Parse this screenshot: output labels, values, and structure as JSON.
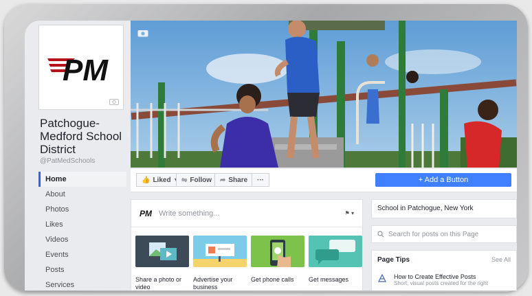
{
  "page": {
    "name": "Patchogue-Medford School District",
    "name_lines": [
      "Patchogue-",
      "Medford School",
      "District"
    ],
    "handle": "@PatMedSchools",
    "logo_text": "PM"
  },
  "nav": [
    {
      "label": "Home",
      "active": true
    },
    {
      "label": "About"
    },
    {
      "label": "Photos"
    },
    {
      "label": "Likes"
    },
    {
      "label": "Videos"
    },
    {
      "label": "Events"
    },
    {
      "label": "Posts"
    },
    {
      "label": "Services"
    }
  ],
  "actions": {
    "liked": "Liked",
    "follow": "Follow",
    "share": "Share",
    "more": "···",
    "add_button": "+ Add a Button"
  },
  "composer": {
    "placeholder": "Write something...",
    "tiles": [
      {
        "label": "Share a photo or video"
      },
      {
        "label": "Advertise your business"
      },
      {
        "label": "Get phone calls"
      },
      {
        "label": "Get messages"
      }
    ]
  },
  "sidebar": {
    "category": "School in Patchogue, New York",
    "search_placeholder": "Search for posts on this Page",
    "tips_title": "Page Tips",
    "tips_see_all": "See All",
    "tip_title": "How to Create Effective Posts",
    "tip_desc": "Short, visual posts created for the right"
  },
  "colors": {
    "brand_blue": "#4267b2",
    "button_blue": "#4080ff",
    "logo_red": "#b5121b",
    "background": "#e9ebee"
  }
}
